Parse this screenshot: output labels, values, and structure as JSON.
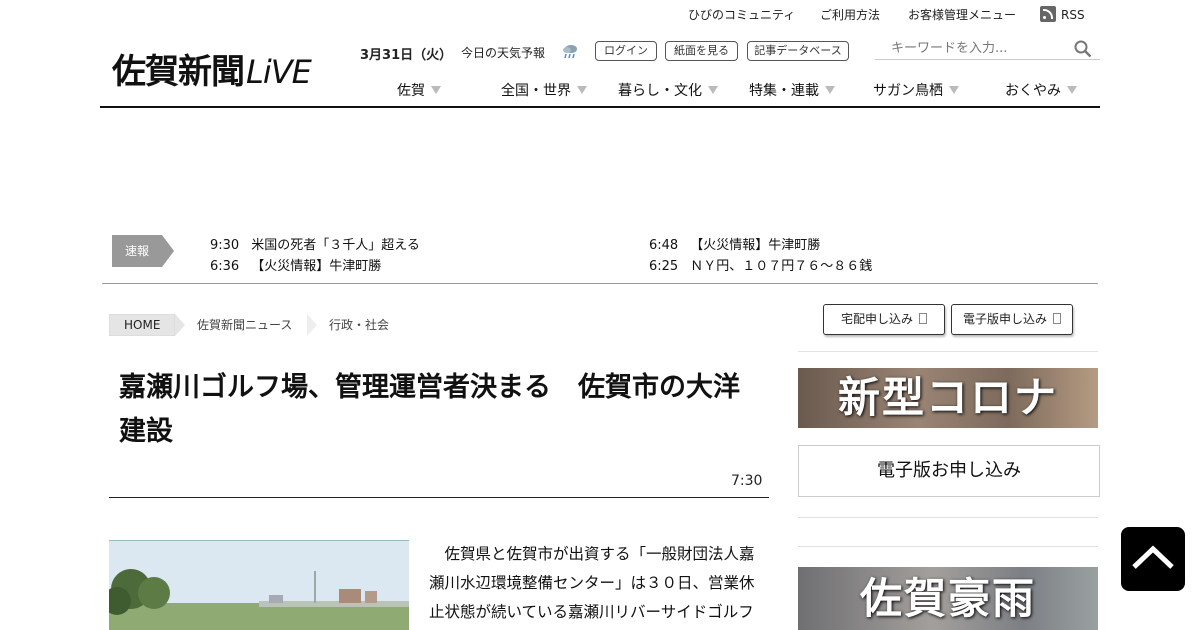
{
  "utility": {
    "community": "ひびのコミュニティ",
    "usage": "ご利用方法",
    "account": "お客様管理メニュー",
    "rss": "RSS"
  },
  "logo": {
    "main": "佐賀新聞",
    "live": "LiVE"
  },
  "header": {
    "date": "3月31日（火）",
    "weather_label": "今日の天気予報",
    "weather_icon": "cloud-rain-icon",
    "buttons": {
      "login": "ログイン",
      "paper": "紙面を見る",
      "database": "記事データベース"
    },
    "search_placeholder": "キーワードを入力..."
  },
  "nav": {
    "items": [
      "佐賀",
      "全国・世界",
      "暮らし・文化",
      "特集・連載",
      "サガン鳥栖",
      "おくやみ"
    ]
  },
  "breaking": {
    "label": "速報",
    "items": [
      {
        "time": "9:30",
        "text": "米国の死者「３千人」超える"
      },
      {
        "time": "6:36",
        "text": "【火災情報】牛津町勝"
      },
      {
        "time": "6:48",
        "text": "【火災情報】牛津町勝"
      },
      {
        "time": "6:25",
        "text": "ＮＹ円、１０７円７６～８６銭"
      }
    ]
  },
  "breadcrumb": [
    "HOME",
    "佐賀新聞ニュース",
    "行政・社会"
  ],
  "article": {
    "headline": "嘉瀬川ゴルフ場、管理運営者決まる　佐賀市の大洋建設",
    "time": "7:30",
    "body": "佐賀県と佐賀市が出資する「一般財団法人嘉瀬川水辺環境整備センター」は３０日、営業休止状態が続いている嘉瀬川リバーサイドゴルフ"
  },
  "sidebar": {
    "delivery_btn": "宅配申し込み",
    "digital_btn": "電子版申し込み",
    "banner_corona": "新型コロナ",
    "denshi_signup": "電子版お申し込み",
    "banner_flood": "佐賀豪雨"
  },
  "colors": {
    "accent": "#000000",
    "breaking_label_bg": "#999999"
  }
}
